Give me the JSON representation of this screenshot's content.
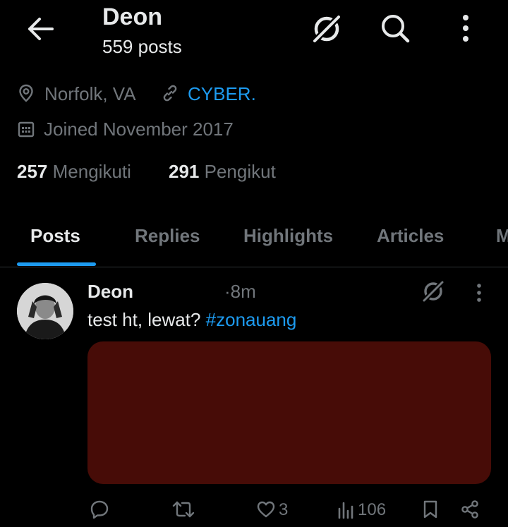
{
  "header": {
    "name": "Deon",
    "post_count": "559 posts",
    "icons": [
      "back-arrow-icon",
      "grok-icon",
      "search-icon",
      "more-vertical-icon"
    ]
  },
  "profile": {
    "location": "Norfolk, VA",
    "website": "CYBER.",
    "joined": "Joined November 2017",
    "following_count": "257",
    "following_label": "Mengikuti",
    "followers_count": "291",
    "followers_label": "Pengikut"
  },
  "tabs": [
    {
      "label": "Posts",
      "active": true
    },
    {
      "label": "Replies",
      "active": false
    },
    {
      "label": "Highlights",
      "active": false
    },
    {
      "label": "Articles",
      "active": false
    },
    {
      "label": "M",
      "active": false
    }
  ],
  "post": {
    "author": "Deon",
    "time": "·8m",
    "text": "test ht, lewat?",
    "hashtag": "#zonauang",
    "media_color": "#470c07",
    "likes": "3",
    "views": "106"
  },
  "colors": {
    "background": "#000000",
    "text_primary": "#e7e9ea",
    "text_secondary": "#71767b",
    "accent": "#1d9bf0",
    "divider": "#2f3336"
  }
}
